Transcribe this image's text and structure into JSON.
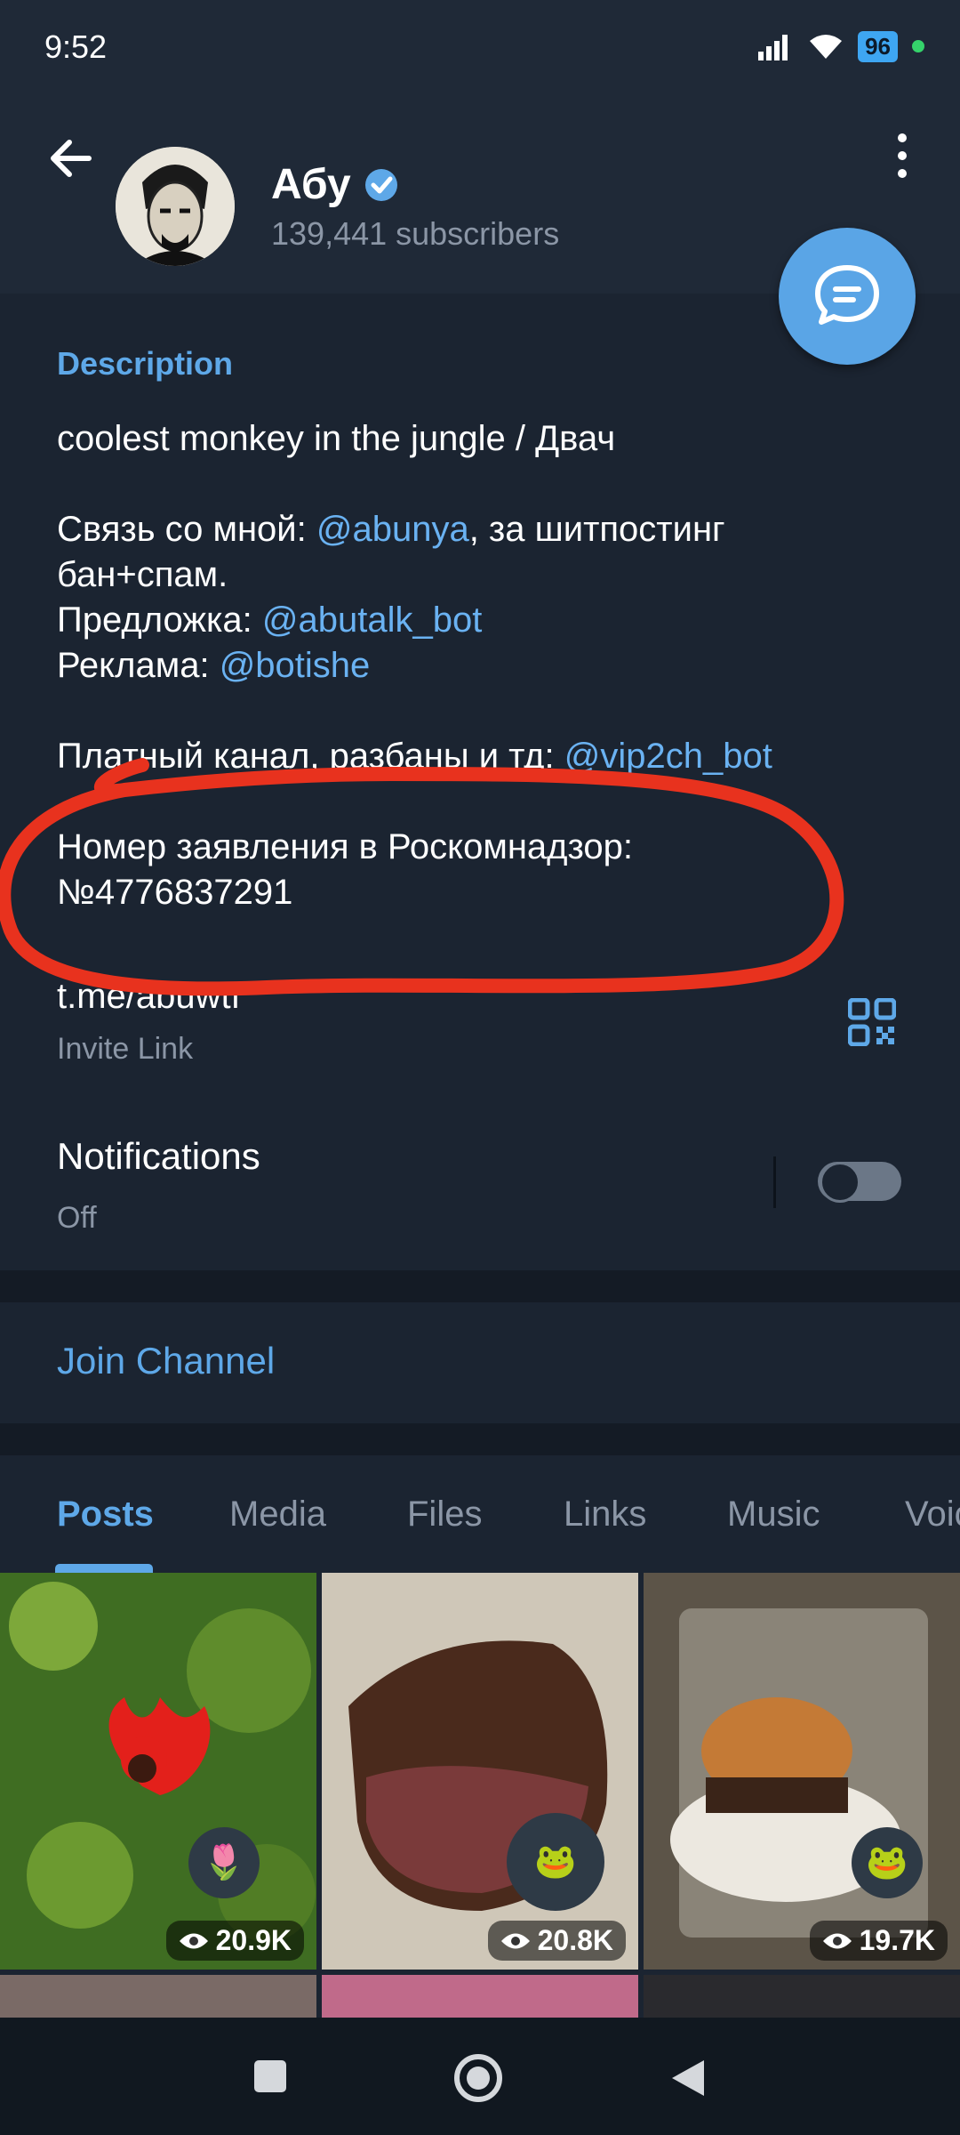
{
  "status": {
    "time": "9:52",
    "battery": "96"
  },
  "header": {
    "title": "Абу",
    "subtitle": "139,441 subscribers"
  },
  "description": {
    "label": "Description",
    "line1": "coolest monkey in the jungle / Двач",
    "line2_prefix": "Связь со мной: ",
    "line2_link": "@abunya",
    "line2_suffix": ",  за шитпостинг",
    "line3": "бан+спам.",
    "line4_prefix": "Предложка: ",
    "line4_link": "@abutalk_bot",
    "line5_prefix": "Реклама: ",
    "line5_link": "@botishe",
    "line6_prefix": "Платный канал, разбаны и тд: ",
    "line6_link": "@vip2ch_bot",
    "line7": "Номер заявления в Роскомнадзор:",
    "line8": "№4776837291"
  },
  "invite": {
    "link": "t.me/abuwtf",
    "label": "Invite Link"
  },
  "notifications": {
    "title": "Notifications",
    "state": "Off"
  },
  "join": {
    "label": "Join Channel"
  },
  "tabs": [
    "Posts",
    "Media",
    "Files",
    "Links",
    "Music",
    "Voice"
  ],
  "posts": [
    {
      "views": "20.9K",
      "sticker": "🌷"
    },
    {
      "views": "20.8K",
      "sticker": "🐸"
    },
    {
      "views": "19.7K",
      "sticker": "🐸"
    }
  ],
  "colors": {
    "accent": "#5ea8e8",
    "link": "#6ab2f2",
    "annotation": "#e8321e"
  }
}
